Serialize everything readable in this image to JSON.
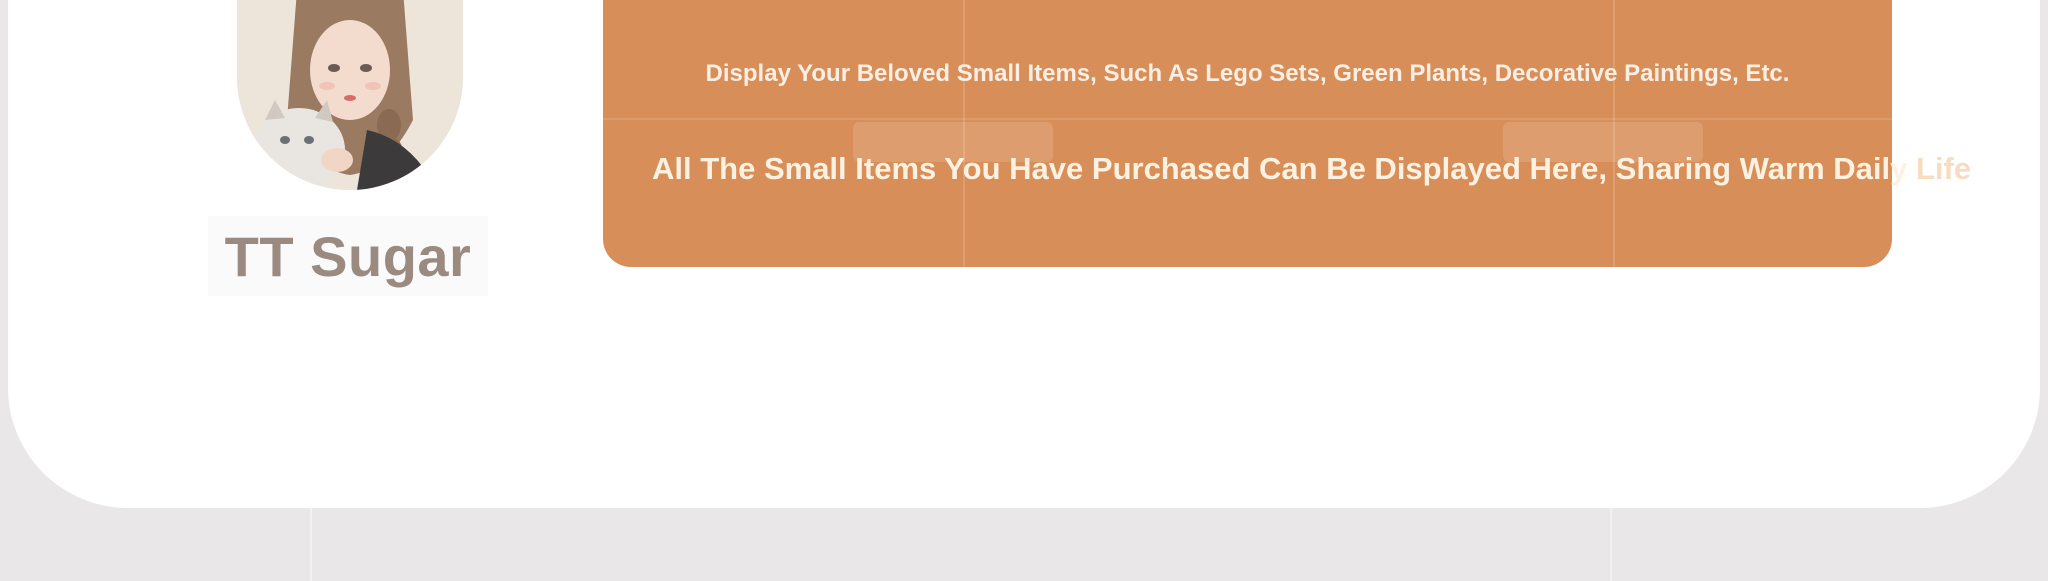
{
  "profile": {
    "username": "TT Sugar",
    "avatar_icon": "avatar-girl-with-cat"
  },
  "banner": {
    "subtitle": "Display Your Beloved Small Items, Such As Lego Sets, Green Plants, Decorative Paintings, Etc.",
    "title_main": "All The Small Items You Have Purchased Can Be Displayed Here, Sharing Warm Daily ",
    "title_tail": "Life",
    "background_color": "#d78e59",
    "text_color": "#fdf2e2"
  },
  "theme": {
    "page_background": "#e9e7e7",
    "card_background": "#ffffff",
    "username_color": "#9a8a80"
  }
}
